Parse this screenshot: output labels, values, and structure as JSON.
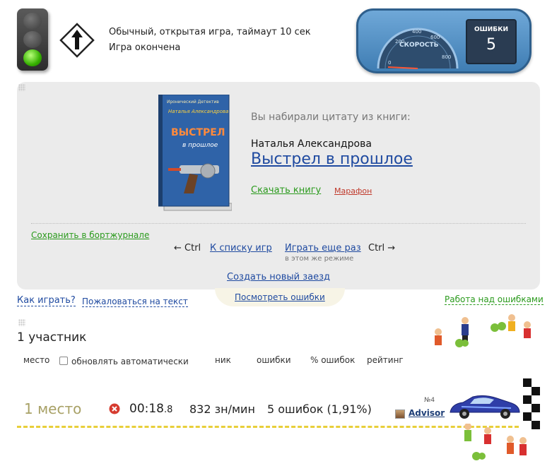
{
  "header": {
    "game_type": "Обычный, открытая игра, таймаут 10 сек",
    "game_status": "Игра окончена",
    "icons": {
      "traffic_light": "traffic-light-icon",
      "direction": "arrow-up-sign-icon"
    }
  },
  "dashboard": {
    "speed_caption": "СКОРОСТЬ",
    "speed_ticks": [
      "0",
      "200",
      "400",
      "600",
      "800"
    ],
    "errors_title": "ОШИБКИ",
    "errors_value": "5"
  },
  "book": {
    "caption": "Вы набирали цитату из книги:",
    "author": "Наталья Александрова",
    "title": "Выстрел в прошлое",
    "download_label": "Скачать книгу",
    "marathon_label": "Марафон",
    "cover_series": "Иронический Детектив",
    "cover_author": "Наталья Александрова",
    "cover_title_top": "ВЫСТРЕЛ",
    "cover_title_bottom": "в прошлое"
  },
  "actions": {
    "save_log": "Сохранить в бортжурнале",
    "ctrl_left": "← Ctrl",
    "back_to_list": "К списку игр",
    "replay": "Играть еще раз",
    "ctrl_right": "Ctrl →",
    "same_mode": "в этом же режиме",
    "new_race": "Создать новый заезд"
  },
  "links": {
    "how_to_play": "Как играть?",
    "complain": "Пожаловаться на текст",
    "view_errors": "Посмотреть ошибки",
    "work_on_errors": "Работа над ошибками"
  },
  "participants": {
    "heading": "1 участник",
    "columns": {
      "place": "место",
      "auto_refresh": "обновлять автоматически",
      "nick": "ник",
      "errors": "ошибки",
      "error_pct": "% ошибок",
      "rating": "рейтинг"
    },
    "auto_refresh_checked": false
  },
  "result": {
    "place": "1 место",
    "time_main": "00:18",
    "time_frac": ".8",
    "speed": "832 зн/мин",
    "errors": "5 ошибок (1,91%)",
    "car_number": "№4",
    "nick": "Advisor",
    "colors": {
      "track": "#e8cf3a",
      "car": "#2f3ea8",
      "place": "#a8a166"
    }
  }
}
